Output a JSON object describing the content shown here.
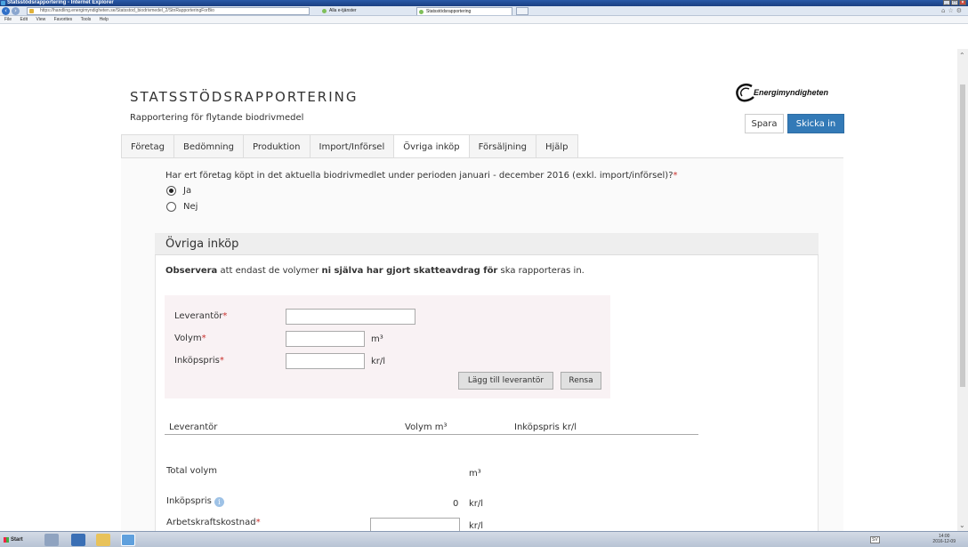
{
  "browser": {
    "window_title": "Statsstödsrapportering - Internet Explorer",
    "url": "https://handling.energimyndigheten.se/Statsstod_biodrivmedel_2/StnRapporteringForBio",
    "tabs": [
      {
        "label": "Alla e-tjänster"
      },
      {
        "label": "Statsstödsrapportering"
      }
    ],
    "menu": [
      "File",
      "Edit",
      "View",
      "Favorites",
      "Tools",
      "Help"
    ]
  },
  "header": {
    "title": "STATSSTÖDSRAPPORTERING",
    "subtitle": "Rapportering för flytande biodrivmedel",
    "logo_text": "Energimyndigheten",
    "save_label": "Spara",
    "submit_label": "Skicka in"
  },
  "nav_tabs": [
    {
      "label": "Företag"
    },
    {
      "label": "Bedömning"
    },
    {
      "label": "Produktion"
    },
    {
      "label": "Import/Införsel"
    },
    {
      "label": "Övriga inköp"
    },
    {
      "label": "Försäljning"
    },
    {
      "label": "Hjälp"
    }
  ],
  "active_tab": "Övriga inköp",
  "question": {
    "text": "Har ert företag köpt in det aktuella biodrivmedlet under perioden januari - december 2016 (exkl. import/införsel)?",
    "required_mark": "*",
    "options": [
      {
        "label": "Ja",
        "checked": true
      },
      {
        "label": "Nej",
        "checked": false
      }
    ]
  },
  "section": {
    "title": "Övriga inköp",
    "notice_bold1": "Observera",
    "notice_mid": " att endast de volymer ",
    "notice_bold2": "ni själva har gjort skatteavdrag för",
    "notice_end": " ska rapporteras in."
  },
  "form": {
    "supplier_label": "Leverantör",
    "volume_label": "Volym",
    "volume_unit": "m³",
    "price_label": "Inköpspris",
    "price_unit": "kr/l",
    "supplier_value": "",
    "volume_value": "",
    "price_value": "",
    "add_button": "Lägg till leverantör",
    "clear_button": "Rensa",
    "required_mark": "*"
  },
  "table": {
    "headers": [
      "Leverantör",
      "Volym m³",
      "Inköpspris kr/l"
    ]
  },
  "summary": {
    "total_volume_label": "Total volym",
    "total_volume_unit": "m³",
    "price_label": "Inköpspris",
    "price_value": "0",
    "price_unit": "kr/l",
    "labor_label": "Arbetskraftskostnad",
    "labor_unit": "kr/l",
    "labor_value": ""
  },
  "taskbar": {
    "start_label": "Start",
    "lang": "SV",
    "time": "14:00",
    "date": "2016-12-09"
  },
  "colors": {
    "primary_button": "#337ab7",
    "required": "#c9302c",
    "form_bg": "#f9f2f4",
    "section_header_bg": "#eeeeee"
  }
}
